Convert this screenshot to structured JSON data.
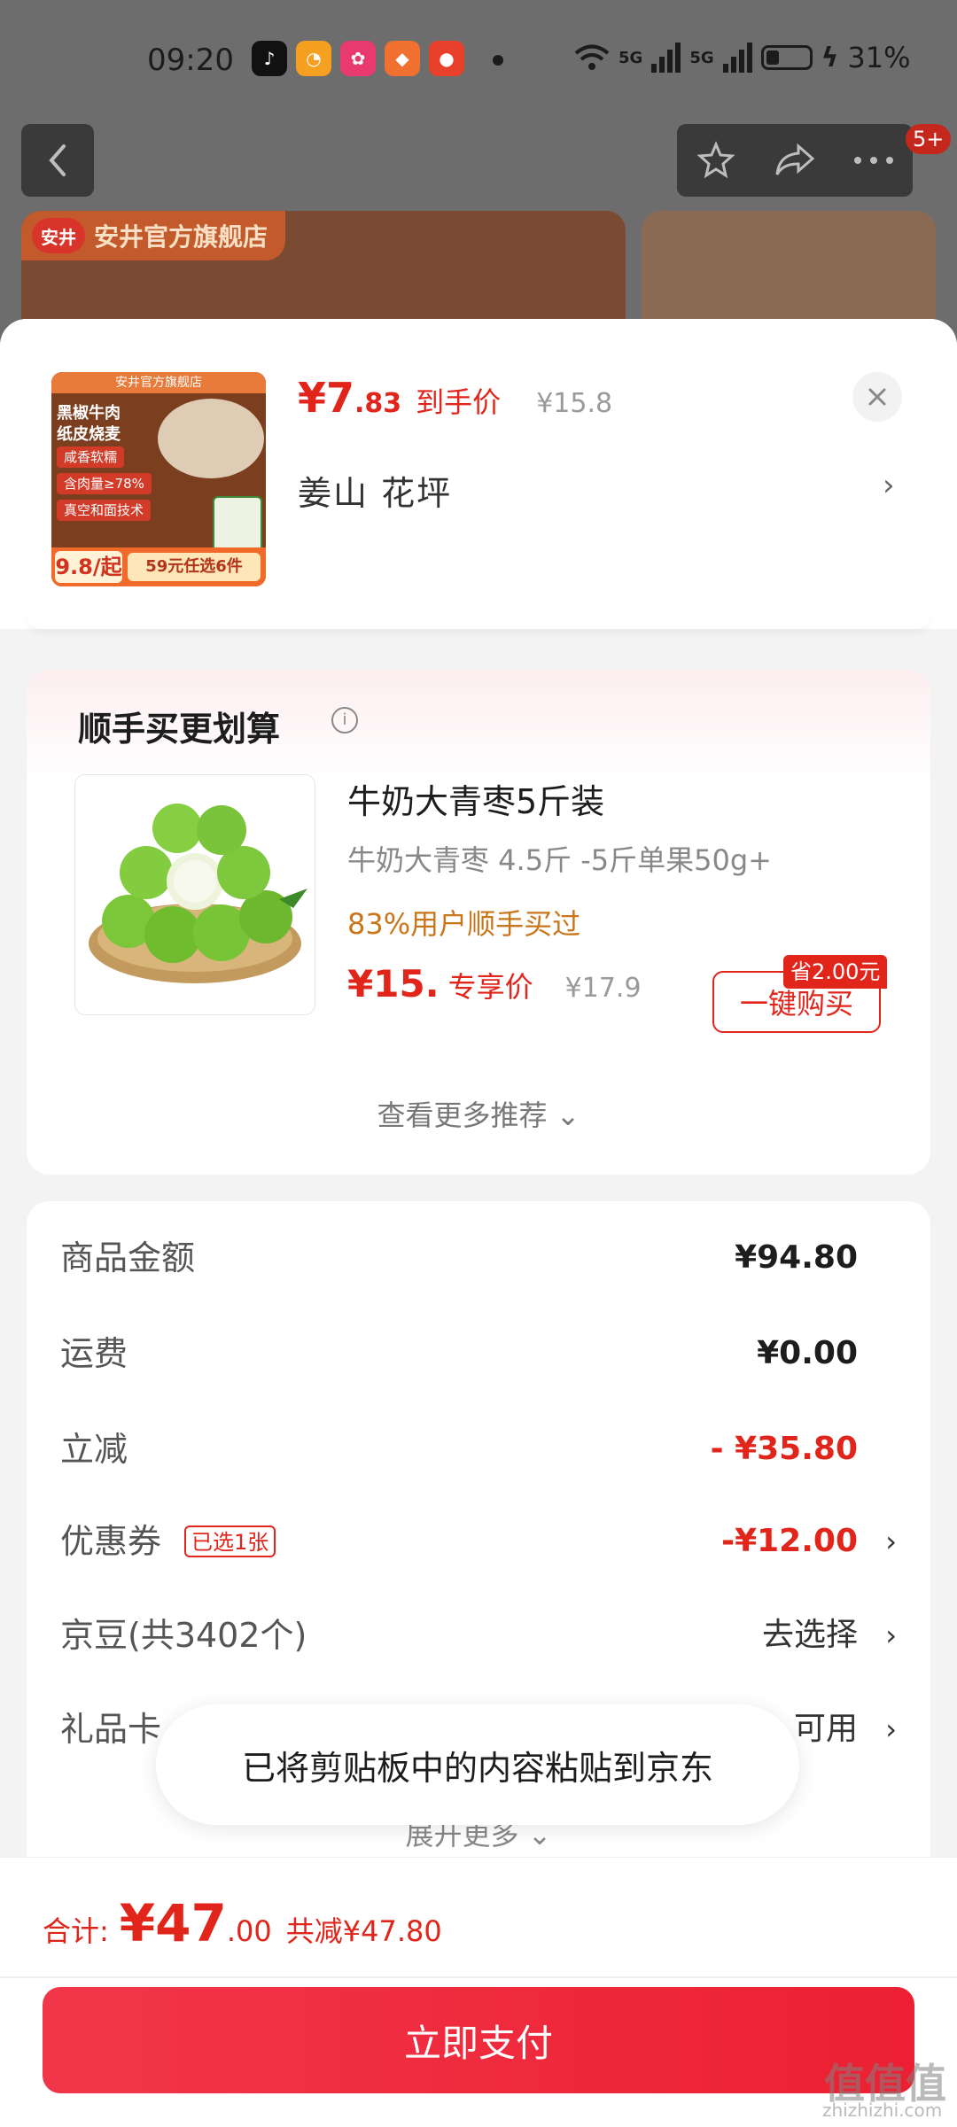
{
  "status_bar": {
    "time": "09:20",
    "network1": "5G",
    "network2": "5G",
    "battery": "31%",
    "app_icons": [
      "tiktok-icon",
      "cat-app-icon",
      "shopping-festival-icon",
      "slow-app-icon",
      "red-app-icon"
    ]
  },
  "background_page": {
    "store_name": "安井官方旗舰店",
    "store_logo_text": "安井",
    "nav_badge": "5+"
  },
  "product": {
    "thumb_top": "安井官方旗舰店",
    "thumb_lines": [
      "黑椒牛肉",
      "纸皮烧麦"
    ],
    "thumb_chips": [
      "咸香软糯",
      "含肉量≥78%",
      "真空和面技术"
    ],
    "thumb_price": "9.8/起",
    "thumb_offer": "59元任选6件",
    "price_int": "¥7",
    "price_dec": ".83",
    "price_label": "到手价",
    "price_original": "¥15.8",
    "address": "姜山  花坪"
  },
  "recommend": {
    "title": "顺手买更划算",
    "name": "牛奶大青枣5斤装",
    "spec": "牛奶大青枣 4.5斤 -5斤单果50g+",
    "stat": "83%用户顺手买过",
    "price": "¥15.",
    "price_label": "专享价",
    "original": "¥17.9",
    "save_badge": "省2.00元",
    "buy_label": "一键购买",
    "more": "查看更多推荐 ⌄"
  },
  "summary": {
    "goods_label": "商品金额",
    "goods_value": "¥94.80",
    "shipping_label": "运费",
    "shipping_value": "¥0.00",
    "discount_label": "立减",
    "discount_value": "- ¥35.80",
    "coupon_label": "优惠券",
    "coupon_tag": "已选1张",
    "coupon_value": "-¥12.00",
    "jingdou_label": "京豆(共3402个)",
    "jingdou_value": "去选择",
    "giftcard_label": "礼品卡",
    "giftcard_value": "可用",
    "expand": "展开更多 ⌄"
  },
  "toast": {
    "text": "已将剪贴板中的内容粘贴到京东"
  },
  "footer": {
    "total_label": "合计:",
    "total_int": "¥47",
    "total_dec": ".00",
    "total_saved": "共减¥47.80",
    "pay_label": "立即支付"
  },
  "watermark": {
    "main": "值值值",
    "sub": "zhizhizhi.com"
  },
  "colors": {
    "accent": "#e1251b",
    "pay_button": "#ec2032",
    "stat_orange": "#c9761a"
  }
}
